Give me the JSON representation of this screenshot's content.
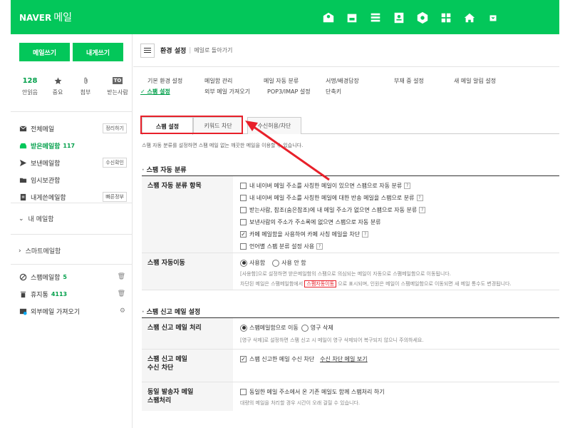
{
  "header": {
    "brand": "NAVER",
    "app": "메일",
    "icons": [
      "mail-app-icon",
      "calendar-icon",
      "list-icon",
      "contacts-icon",
      "hexagon-icon",
      "grid-icon",
      "home-icon",
      "more-icon"
    ],
    "accent": "#03c75a"
  },
  "sidebar": {
    "compose_label": "메일쓰기",
    "self_label": "내게쓰기",
    "quick": [
      {
        "top": "128",
        "label": "안읽음"
      },
      {
        "top": "",
        "label": "중요"
      },
      {
        "top": "",
        "label": "첨부"
      },
      {
        "top": "TO",
        "label": "받는사람"
      }
    ],
    "folders": [
      {
        "name": "전체메일",
        "btn": "정리하기"
      },
      {
        "name": "받은메일함",
        "count": "117"
      },
      {
        "name": "보낸메일함",
        "btn": "수신확인"
      },
      {
        "name": "임시보관함"
      },
      {
        "name": "내게쓴메일함",
        "btn": "빠른정부"
      }
    ],
    "my_mailbox": "내 메일함",
    "smart_mailbox": "스마트메일함",
    "bottom_folders": [
      {
        "name": "스팸메일함",
        "count": "5"
      },
      {
        "name": "휴지통",
        "count": "4113"
      },
      {
        "name": "외부메일 가져오기"
      }
    ]
  },
  "main": {
    "title": "환경 설정",
    "back": "메일로 돌아가기",
    "menu_row1": [
      "기본 환경 설정",
      "메일함 관리",
      "메일 자동 분류",
      "서명/배경답장",
      "부재 중 설정",
      "새 메일 알림 설정"
    ],
    "menu_row2": [
      "스팸 설정",
      "외부 메일 가져오기",
      "POP3/IMAP 설정",
      "단축키"
    ],
    "selected_menu": "스팸 설정",
    "tabs": [
      "스팸 설정",
      "키워드 차단",
      "수신허용/차단"
    ],
    "description": "스팸 자동 분류를 설정하면 스팸 메일 없는 깨끗한 메일을 이용할 수 있습니다.",
    "section1": "스팸 자동 분류",
    "section2": "스팸 신고 메일 설정",
    "auto_label": "스팸 자동 분류 항목",
    "auto_options": [
      {
        "text": "내 네이버 메일 주소를 사칭한 메일이 있으면 스팸으로 자동 분류",
        "checked": false,
        "help": true
      },
      {
        "text": "내 네이버 메일 주소를 사칭한 메일에 대한 반송 메일을 스팸으로 분류",
        "checked": false,
        "help": true
      },
      {
        "text": "받는사람, 참조(숨은참조)에 내 메일 주소가 없으면 스팸으로 자동 분류",
        "checked": false,
        "help": true
      },
      {
        "text": "보낸사람의 주소가 주소록에 없으면 스팸으로 자동 분류",
        "checked": false,
        "help": false
      },
      {
        "text": "카페 메일함을 사용하여 카페 사칭 메일을 차단",
        "checked": true,
        "help": true
      },
      {
        "text": "언어별 스팸 분류 설정 사용",
        "checked": false,
        "help": true
      }
    ],
    "move_label": "스팸 자동이동",
    "move_on": "사용함",
    "move_off": "사용 안 함",
    "move_note1": "[사용함]으로 설정하면 받은메일함의 스팸으로 의심되는 메일이 자동으로 스팸메일함으로 이동됩니다.",
    "move_note2a": "차단된 메일은 스팸메일함에서",
    "move_note2_tag": "스팸자동이동",
    "move_note2b": "으로 표시되며, 인원은 메일이 스팸메일함으로 이동되면 새 메일 통수도 변경됩니다.",
    "report_label": "스팸 신고 메일 처리",
    "report_opt1": "스팸메일함으로 이동",
    "report_opt2": "영구 삭제",
    "report_note": "[영구 삭제]로 설정하면 스팸 신고 시 메일이 영구 삭제되어 복구되지 않으니 주의하세요.",
    "block_label1": "스팸 신고 메일",
    "block_label2": "수신 차단",
    "block_opt": "스팸 신고한 메일 수신 차단",
    "block_link": "수신 차단 메일 보기",
    "same_label1": "동일 발송자 메일",
    "same_label2": "스팸처리",
    "same_opt": "동일한 메일 주소에서 온 기존 메일도 함께 스팸처리 하기",
    "same_note": "대량의 메일을 처리할 경우 시간이 오래 걸릴 수 있습니다."
  }
}
